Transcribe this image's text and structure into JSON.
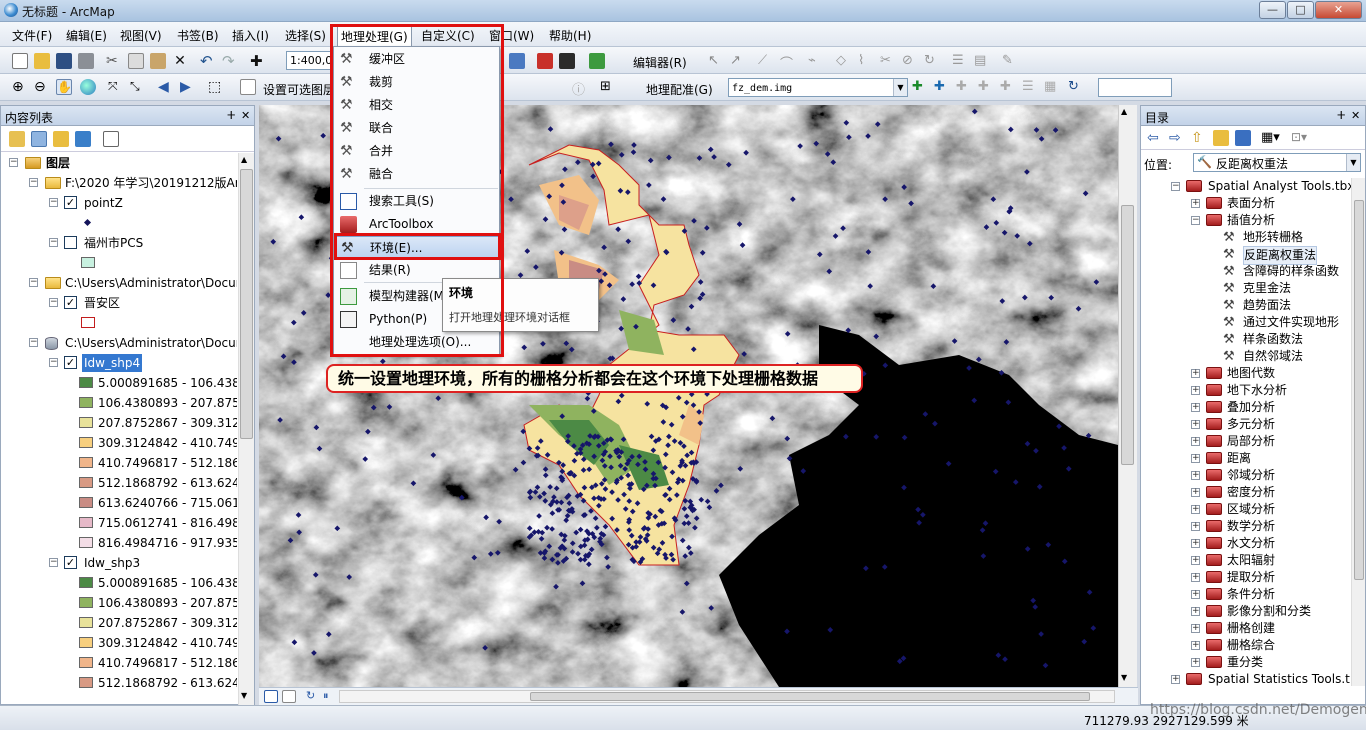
{
  "window": {
    "title": "无标题 - ArcMap",
    "minimize": "—",
    "maximize": "□",
    "close": "✕"
  },
  "menubar": [
    "文件(F)",
    "编辑(E)",
    "视图(V)",
    "书签(B)",
    "插入(I)",
    "选择(S)",
    "地理处理(G)",
    "自定义(C)",
    "窗口(W)",
    "帮助(H)"
  ],
  "toolbar": {
    "scale": "1:400,0",
    "selectable_layers": "设置可选图层",
    "editor": "编辑器(R)",
    "georef": "地理配准(G)",
    "georef_layer": "fz_dem.img"
  },
  "toc": {
    "title": "内容列表",
    "pin": "ⵜ",
    "close": "✕",
    "root": "图层",
    "groups": [
      {
        "path": "F:\\2020 年学习\\20191212版Arc",
        "layers": [
          {
            "name": "pointZ",
            "checked": true
          },
          {
            "name": "福州市PCS",
            "checked": false
          }
        ]
      },
      {
        "path": "C:\\Users\\Administrator\\Docur",
        "layers": [
          {
            "name": "晋安区",
            "checked": true
          }
        ]
      },
      {
        "path": "C:\\Users\\Administrator\\Docur",
        "layers": [
          {
            "name": "Idw_shp4",
            "checked": true
          },
          {
            "name": "Idw_shp3",
            "checked": true
          }
        ]
      }
    ],
    "idw4_classes": [
      "5.000891685 - 106.4380",
      "106.4380893 - 207.8752",
      "207.8752867 - 309.3124",
      "309.3124842 - 410.7496",
      "410.7496817 - 512.1868",
      "512.1868792 - 613.6240",
      "613.6240766 - 715.0612",
      "715.0612741 - 816.4984",
      "816.4984716 - 917.9356"
    ],
    "idw3_classes": [
      "5.000891685 - 106.4380",
      "106.4380893 - 207.8752",
      "207.8752867 - 309.3124",
      "309.3124842 - 410.7496",
      "410.7496817 - 512.1868",
      "512.1868792 - 613.6240"
    ],
    "class_colors": [
      "#4c8a45",
      "#8fb35f",
      "#e8e29a",
      "#f7cf7e",
      "#f0b58a",
      "#d89a84",
      "#c98c84",
      "#e6b9c8",
      "#f3dde6"
    ]
  },
  "geomenu": {
    "items": [
      "缓冲区",
      "裁剪",
      "相交",
      "联合",
      "合并",
      "融合",
      "搜索工具(S)",
      "ArcToolbox",
      "环境(E)...",
      "结果(R)",
      "模型构建器(M)",
      "Python(P)",
      "地理处理选项(O)..."
    ]
  },
  "tooltip": {
    "title": "环境",
    "text": "打开地理处理环境对话框"
  },
  "callout": "统一设置地理环境，所有的栅格分析都会在这个环境下处理栅格数据",
  "catalog": {
    "title": "目录",
    "location_label": "位置:",
    "location_value": "反距离权重法",
    "toolbox": "Spatial Analyst Tools.tbx",
    "sets_before": [
      "表面分析"
    ],
    "interp": "插值分析",
    "interp_tools": [
      "地形转栅格",
      "反距离权重法",
      "含障碍的样条函数",
      "克里金法",
      "趋势面法",
      "通过文件实现地形",
      "样条函数法",
      "自然邻域法"
    ],
    "sets_after": [
      "地图代数",
      "地下水分析",
      "叠加分析",
      "多元分析",
      "局部分析",
      "距离",
      "邻域分析",
      "密度分析",
      "区域分析",
      "数学分析",
      "水文分析",
      "太阳辐射",
      "提取分析",
      "条件分析",
      "影像分割和分类",
      "栅格创建",
      "栅格综合",
      "重分类"
    ],
    "toolbox2": "Spatial Statistics Tools.t"
  },
  "status": {
    "coords": "711279.93  2927129.599 米",
    "watermark": "https://blog.csdn.net/Demogenl"
  }
}
